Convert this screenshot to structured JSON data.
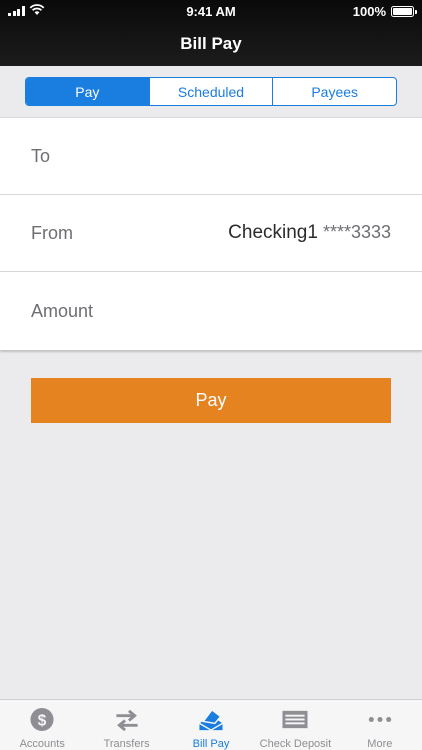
{
  "status_bar": {
    "time": "9:41 AM",
    "battery": "100%",
    "battery_level": 1.0
  },
  "header": {
    "title": "Bill Pay"
  },
  "segments": [
    {
      "label": "Pay",
      "active": true
    },
    {
      "label": "Scheduled",
      "active": false
    },
    {
      "label": "Payees",
      "active": false
    }
  ],
  "form": {
    "to_label": "To",
    "from_label": "From",
    "from_account_name": "Checking1",
    "from_account_mask": "****3333",
    "amount_label": "Amount"
  },
  "pay_button": {
    "label": "Pay",
    "color": "#e68321"
  },
  "tab_bar": {
    "accent": "#1a7de0",
    "tabs": [
      {
        "label": "Accounts",
        "icon": "dollar-coin-icon",
        "active": false
      },
      {
        "label": "Transfers",
        "icon": "transfer-arrows-icon",
        "active": false
      },
      {
        "label": "Bill Pay",
        "icon": "bill-pay-icon",
        "active": true
      },
      {
        "label": "Check Deposit",
        "icon": "check-icon",
        "active": false
      },
      {
        "label": "More",
        "icon": "more-dots-icon",
        "active": false
      }
    ]
  }
}
